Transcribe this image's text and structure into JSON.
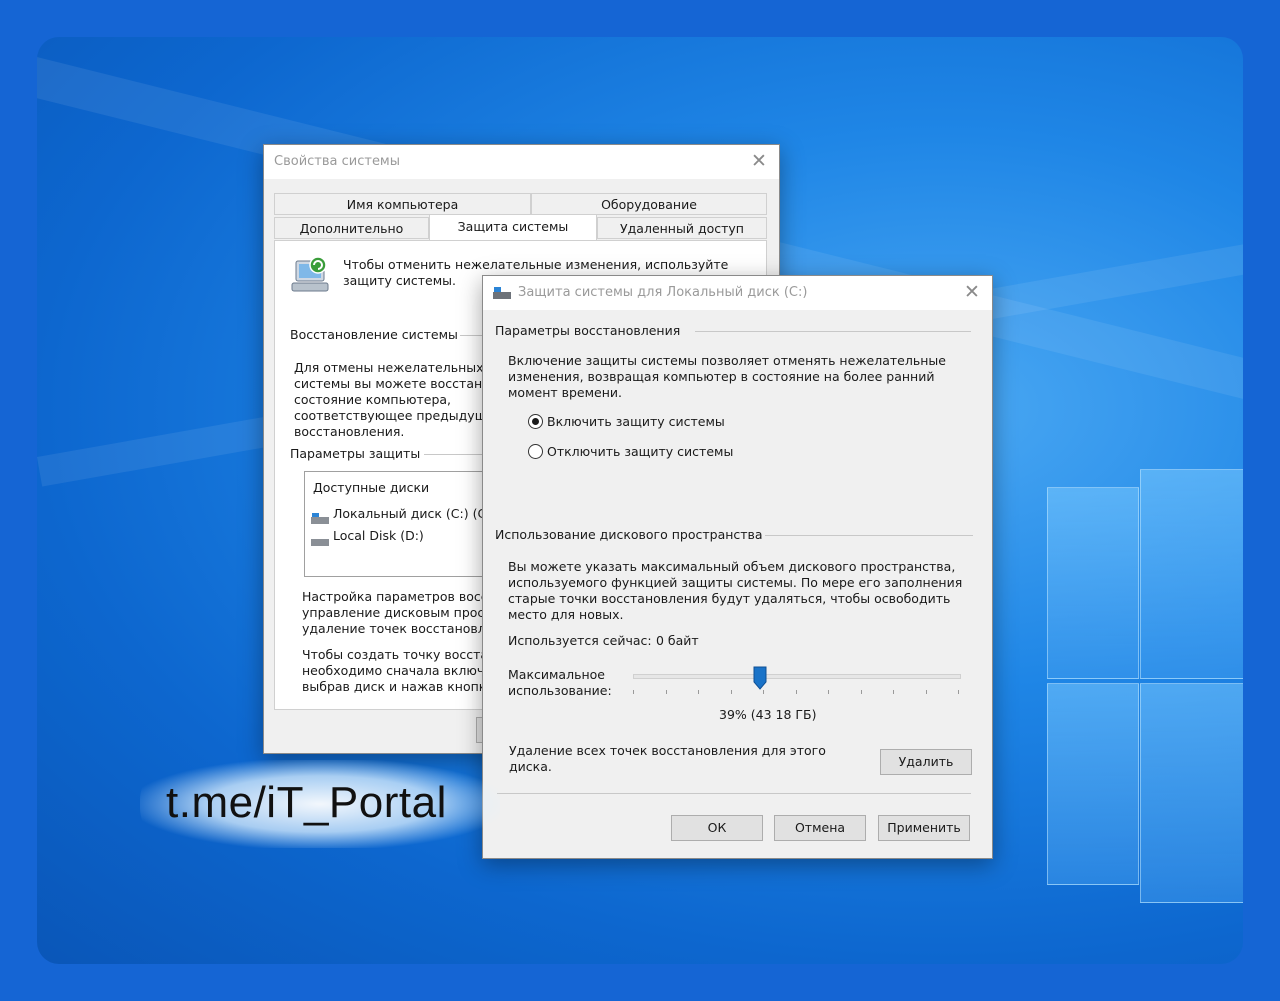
{
  "back_window": {
    "title": "Свойства системы",
    "tabs_row1": [
      "Имя компьютера",
      "Оборудование"
    ],
    "tabs_row2": [
      "Дополнительно",
      "Защита системы",
      "Удаленный доступ"
    ],
    "active_tab": "Защита системы",
    "intro": "Чтобы отменить нежелательные изменения, используйте\nзащиту системы.",
    "restore_section": "Восстановление системы",
    "restore_text": "Для отмены нежелательных\nсистемы вы можете восстан\nсостояние компьютера,\nсоответствующее предыдуще\nвосстановления.",
    "protection_section": "Параметры защиты",
    "disks_header": "Доступные диски",
    "disks": [
      "Локальный диск (C:) (Си",
      "Local Disk (D:)"
    ],
    "config_text": "Настройка параметров восс\nуправление дисковым прост\nудаление точек восстановле",
    "create_text": "Чтобы создать точку восста\nнеобходимо сначала включи\nвыбрав диск и нажав кнопку"
  },
  "front_window": {
    "title": "Защита системы для Локальный диск (C:)",
    "restore_params_header": "Параметры восстановления",
    "restore_params_text": "Включение защиты системы позволяет отменять нежелательные\nизменения, возвращая компьютер в состояние на более ранний\nмомент времени.",
    "radio_enable": "Включить защиту системы",
    "radio_disable": "Отключить защиту системы",
    "selected_option": "enable",
    "disk_usage_header": "Использование дискового пространства",
    "disk_usage_text": "Вы можете указать максимальный объем дискового пространства,\nиспользуемого функцией защиты системы. По мере его заполнения\nстарые точки восстановления будут удаляться, чтобы освободить\nместо для новых.",
    "current_usage_label": "Используется сейчас:",
    "current_usage_value": "0 байт",
    "max_usage_label": "Максимальное\nиспользование:",
    "slider_fraction": 0.39,
    "slider_value_text": "39% (43 18 ГБ)",
    "delete_text": "Удаление всех точек восстановления для этого\nдиска.",
    "delete_button": "Удалить",
    "ok_button": "ОК",
    "cancel_button": "Отмена",
    "apply_button": "Применить"
  },
  "watermark": "t.me/iT_Portal",
  "colors": {
    "desktop_bg": "#1565d4",
    "window_bg": "#f0f0f0",
    "slider_thumb": "#1a73c8"
  }
}
